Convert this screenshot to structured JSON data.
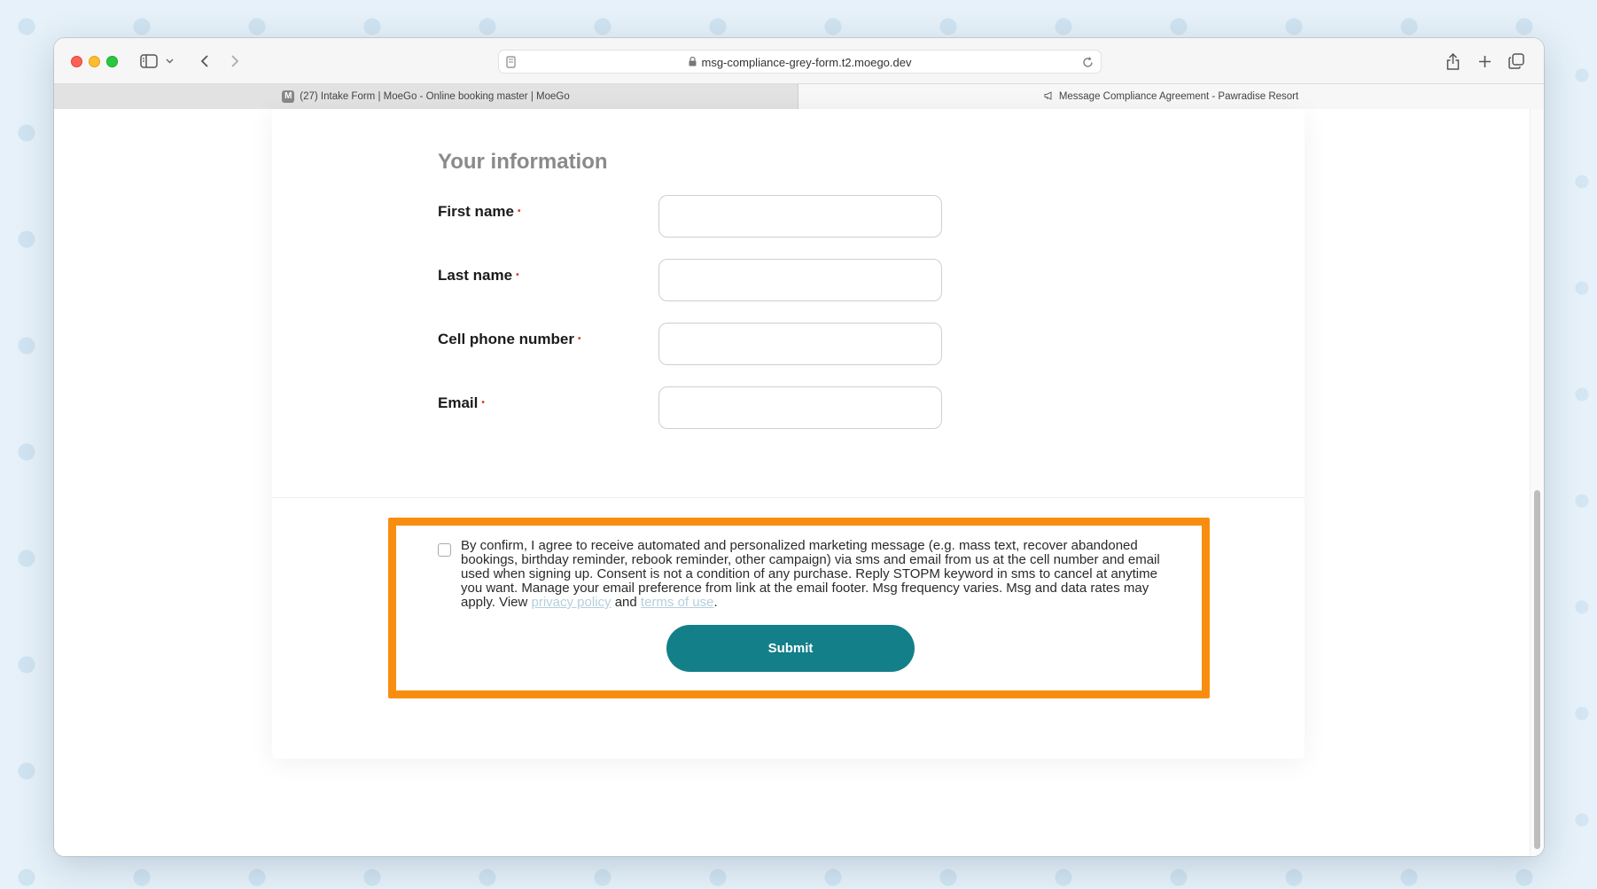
{
  "browser": {
    "url": "msg-compliance-grey-form.t2.moego.dev",
    "tabs": [
      {
        "label": "(27) Intake Form | MoeGo - Online booking master | MoeGo",
        "favicon": "M",
        "active": false
      },
      {
        "label": "Message Compliance Agreement - Pawradise Resort",
        "active": true
      }
    ]
  },
  "form": {
    "section_title": "Your information",
    "required_mark": "•",
    "fields": [
      {
        "label": "First name",
        "value": ""
      },
      {
        "label": "Last name",
        "value": ""
      },
      {
        "label": "Cell phone number",
        "value": ""
      },
      {
        "label": "Email",
        "value": ""
      }
    ],
    "consent": {
      "text": "By confirm, I agree to receive automated and personalized marketing message (e.g. mass text, recover abandoned bookings, birthday reminder, rebook reminder, other campaign) via sms and email from us at the cell number and email used when signing up. Consent is not a condition of any purchase. Reply STOPM keyword in sms to cancel at anytime you want. Manage your email preference from link at the email footer. Msg frequency varies. Msg and data rates may apply. View",
      "privacy_link": "privacy policy",
      "and": "and",
      "terms_link": "terms of use",
      "end": ".",
      "checked": false
    },
    "submit_label": "Submit"
  },
  "colors": {
    "highlight": "#f98d0f",
    "submit_bg": "#137f89",
    "required": "#e5372b"
  }
}
